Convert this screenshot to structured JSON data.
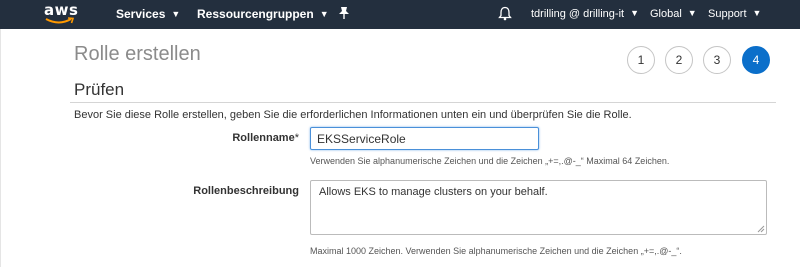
{
  "nav": {
    "logo": "aws",
    "services": "Services",
    "resource_groups": "Ressourcengruppen",
    "pin_icon": "pin-icon",
    "bell_icon": "bell-icon",
    "user": "tdrilling @ drilling-it",
    "region": "Global",
    "support": "Support"
  },
  "page": {
    "title": "Rolle erstellen",
    "steps": [
      "1",
      "2",
      "3",
      "4"
    ],
    "active_step": "4",
    "section_title": "Prüfen",
    "intro": "Bevor Sie diese Rolle erstellen, geben Sie die erforderlichen Informationen unten ein und überprüfen Sie die Rolle."
  },
  "form": {
    "role_name_label": "Rollenname",
    "required_marker": "*",
    "role_name_value": "EKSServiceRole",
    "role_name_hint": "Verwenden Sie alphanumerische Zeichen und die Zeichen „+=,.@-_“ Maximal 64 Zeichen.",
    "description_label": "Rollenbeschreibung",
    "description_value": "Allows EKS to manage clusters on your behalf.",
    "description_hint": "Maximal 1000 Zeichen. Verwenden Sie alphanumerische Zeichen und die Zeichen „+=,.@-_“."
  },
  "colors": {
    "navbar": "#232f3e",
    "accent": "#0b6fca",
    "aws_orange": "#ff9900"
  }
}
